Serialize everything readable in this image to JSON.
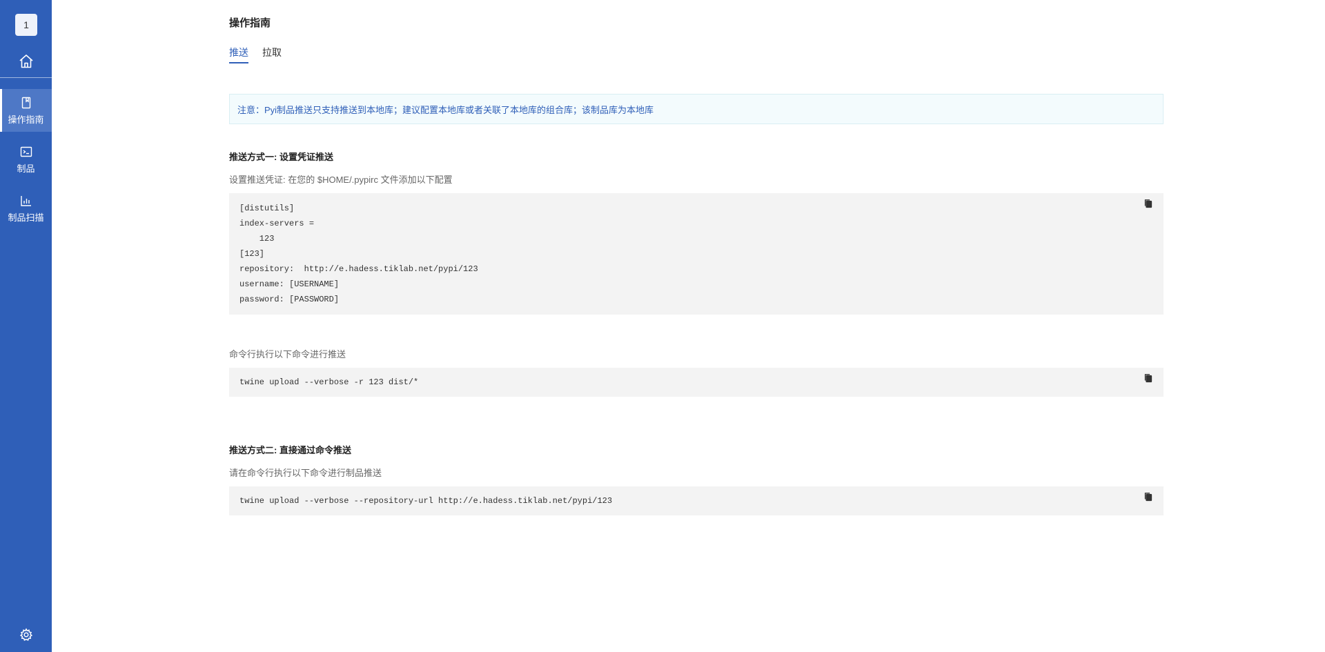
{
  "sidebar": {
    "repo_badge": "1",
    "home_icon": "home-icon",
    "items": [
      {
        "label": "操作指南",
        "icon": "document-icon",
        "active": true
      },
      {
        "label": "制品",
        "icon": "terminal-icon",
        "active": false
      },
      {
        "label": "制品扫描",
        "icon": "bar-chart-icon",
        "active": false
      }
    ],
    "settings_icon": "gear-icon"
  },
  "main": {
    "title": "操作指南",
    "tabs": [
      {
        "label": "推送",
        "active": true
      },
      {
        "label": "拉取",
        "active": false
      }
    ],
    "notice": "注意：Pyi制品推送只支持推送到本地库；建议配置本地库或者关联了本地库的组合库；该制品库为本地库",
    "method1": {
      "title": "推送方式一: 设置凭证推送",
      "desc": "设置推送凭证: 在您的 $HOME/.pypirc 文件添加以下配置",
      "config_code": "[distutils]\nindex-servers =\n    123\n[123]\nrepository:  http://e.hadess.tiklab.net/pypi/123\nusername: [USERNAME]\npassword: [PASSWORD]",
      "cmd_desc": "命令行执行以下命令进行推送",
      "cmd_code": "twine upload --verbose -r 123 dist/*"
    },
    "method2": {
      "title": "推送方式二: 直接通过命令推送",
      "desc": "请在命令行执行以下命令进行制品推送",
      "cmd_code": "twine upload --verbose --repository-url http://e.hadess.tiklab.net/pypi/123"
    },
    "copy_icon": "copy-icon"
  },
  "colors": {
    "sidebar_bg": "#2f5fb8",
    "sidebar_active": "#4e78c6",
    "accent": "#2f5fb8",
    "code_bg": "#f3f3f3",
    "notice_bg": "#f3fbfd"
  }
}
